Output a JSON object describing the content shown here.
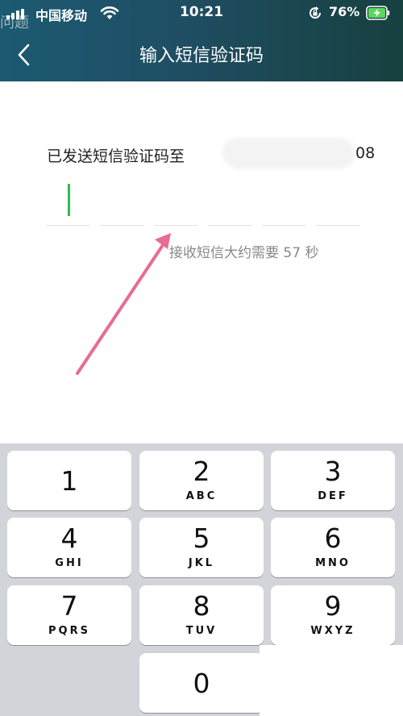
{
  "status_bar": {
    "carrier": "中国移动",
    "time": "10:21",
    "battery_percent": "76%"
  },
  "watermark": "问题",
  "nav": {
    "title": "输入短信验证码"
  },
  "content": {
    "sms_sent_label": "已发送短信验证码至",
    "phone_suffix": "08",
    "countdown": "接收短信大约需要 57 秒"
  },
  "keypad": {
    "keys": [
      {
        "digit": "1",
        "letters": ""
      },
      {
        "digit": "2",
        "letters": "ABC"
      },
      {
        "digit": "3",
        "letters": "DEF"
      },
      {
        "digit": "4",
        "letters": "GHI"
      },
      {
        "digit": "5",
        "letters": "JKL"
      },
      {
        "digit": "6",
        "letters": "MNO"
      },
      {
        "digit": "7",
        "letters": "PQRS"
      },
      {
        "digit": "8",
        "letters": "TUV"
      },
      {
        "digit": "9",
        "letters": "WXYZ"
      },
      {
        "digit": "0",
        "letters": ""
      }
    ]
  },
  "colors": {
    "caret": "#2bbf4e",
    "annotation_arrow": "#e86b93",
    "header_gradient_start": "#1c5a72",
    "header_gradient_end": "#17403f"
  }
}
